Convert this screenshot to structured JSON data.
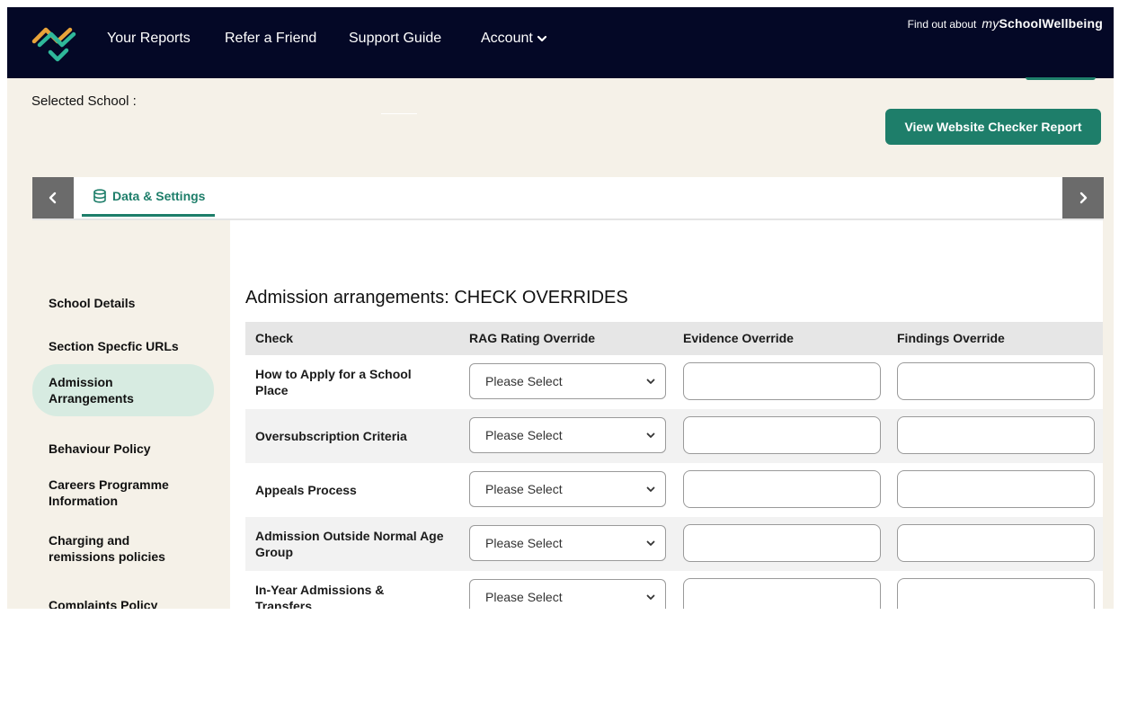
{
  "nav": {
    "links": [
      "Your Reports",
      "Refer a Friend",
      "Support Guide"
    ],
    "account_label": "Account",
    "findout_text": "Find out about",
    "brand_prefix": "my",
    "brand_name": "SchoolWellbeing",
    "accent_colors": [
      "#e8a33a",
      "#2fb89a"
    ]
  },
  "school_bar": {
    "selected_label": "Selected School :",
    "report_button": "View Website Checker Report"
  },
  "tabs": {
    "active_label": "Data & Settings",
    "active_icon": "database-icon",
    "prev_icon": "chevron-left-icon",
    "next_icon": "chevron-right-icon"
  },
  "sidebar": {
    "items": [
      {
        "label": "School Details",
        "active": false
      },
      {
        "label": "Section Specfic URLs",
        "active": false
      },
      {
        "label": "Admission Arrangements",
        "active": true
      },
      {
        "label": "Behaviour Policy",
        "active": false
      },
      {
        "label": "Careers Programme Information",
        "active": false
      },
      {
        "label": "Charging and remissions policies",
        "active": false
      },
      {
        "label": "Complaints Policy",
        "active": false
      }
    ]
  },
  "main": {
    "section_title": "Admission arrangements: CHECK OVERRIDES",
    "columns": [
      "Check",
      "RAG Rating Override",
      "Evidence Override",
      "Findings Override"
    ],
    "select_placeholder": "Please Select",
    "rows": [
      {
        "check": "How to Apply for a School Place",
        "rag": "Please Select",
        "evidence": "",
        "findings": ""
      },
      {
        "check": "Oversubscription Criteria",
        "rag": "Please Select",
        "evidence": "",
        "findings": ""
      },
      {
        "check": "Appeals Process",
        "rag": "Please Select",
        "evidence": "",
        "findings": ""
      },
      {
        "check": "Admission Outside Normal Age Group",
        "rag": "Please Select",
        "evidence": "",
        "findings": ""
      },
      {
        "check": "In-Year Admissions & Transfers",
        "rag": "Please Select",
        "evidence": "",
        "findings": ""
      }
    ]
  },
  "colors": {
    "nav_bg": "#040826",
    "page_bg": "#f5f1e8",
    "brand_green": "#1e7e6a",
    "active_sidebar_bg": "#d7ebe1"
  }
}
